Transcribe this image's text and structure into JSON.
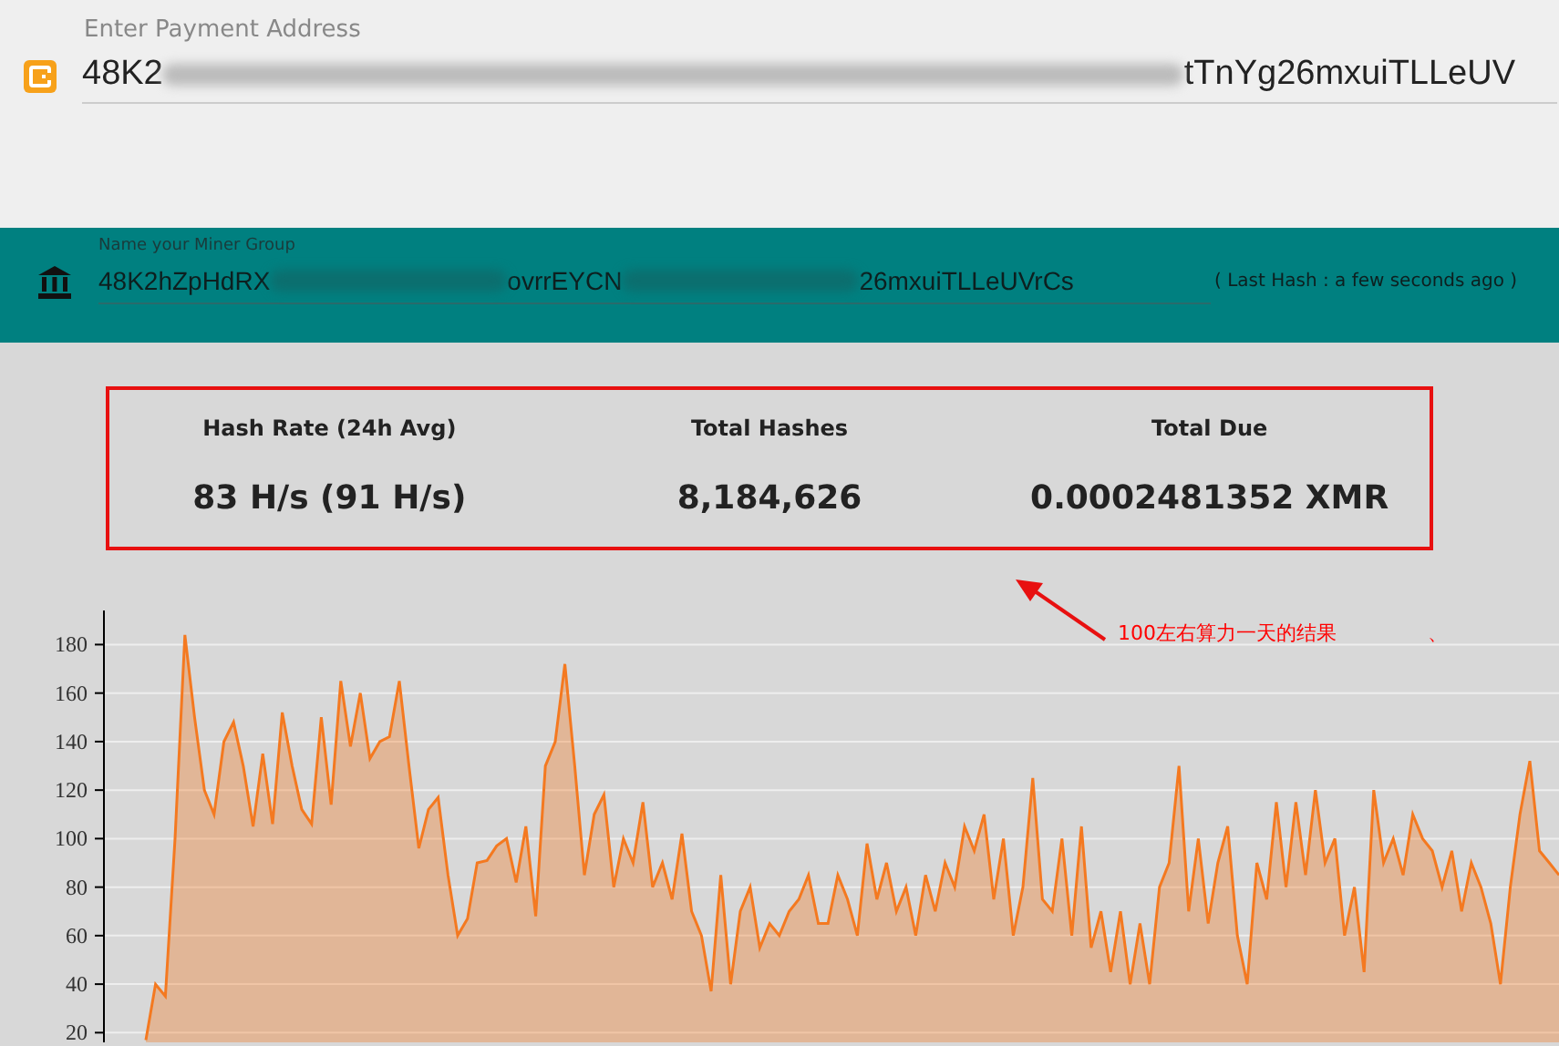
{
  "payment_address": {
    "label": "Enter Payment Address",
    "segments": [
      {
        "kind": "text",
        "text": "48K2"
      },
      {
        "kind": "redacted"
      },
      {
        "kind": "text",
        "text": "tTnYg26mxuiTLLeUV"
      }
    ]
  },
  "miner_group": {
    "label": "Name your Miner Group",
    "segments": [
      {
        "kind": "text",
        "text": "48K2hZpHdRX"
      },
      {
        "kind": "redacted"
      },
      {
        "kind": "text",
        "text": "ovrrEYCN"
      },
      {
        "kind": "redacted"
      },
      {
        "kind": "text",
        "text": "26mxuiTLLeUVrCs"
      }
    ],
    "last_hash": "( Last Hash : a few seconds ago )"
  },
  "stats": [
    {
      "label": "Hash Rate (24h Avg)",
      "value": "83 H/s (91 H/s)"
    },
    {
      "label": "Total Hashes",
      "value": "8,184,626"
    },
    {
      "label": "Total Due",
      "value": "0.0002481352 XMR"
    }
  ],
  "annotation": {
    "text": "100左右算力一天的结果",
    "mark": "、"
  },
  "chart_data": {
    "type": "area",
    "ylim": [
      16,
      194
    ],
    "yticks": [
      20,
      40,
      60,
      80,
      100,
      120,
      140,
      160,
      180
    ],
    "grid": true,
    "series": [
      {
        "color": "#f47920",
        "values": [
          17,
          40,
          35,
          100,
          184,
          150,
          120,
          110,
          140,
          148,
          130,
          105,
          135,
          106,
          152,
          130,
          112,
          106,
          150,
          114,
          165,
          138,
          160,
          133,
          140,
          142,
          165,
          130,
          96,
          112,
          117,
          85,
          60,
          67,
          90,
          91,
          97,
          100,
          82,
          105,
          68,
          130,
          140,
          172,
          130,
          85,
          110,
          118,
          80,
          100,
          90,
          115,
          80,
          90,
          75,
          102,
          70,
          60,
          37,
          85,
          40,
          70,
          80,
          55,
          65,
          60,
          70,
          75,
          85,
          65,
          65,
          85,
          75,
          60,
          98,
          75,
          90,
          70,
          80,
          60,
          85,
          70,
          90,
          80,
          105,
          95,
          110,
          75,
          100,
          60,
          80,
          125,
          75,
          70,
          100,
          60,
          105,
          55,
          70,
          45,
          70,
          40,
          65,
          40,
          80,
          90,
          130,
          70,
          100,
          65,
          90,
          105,
          60,
          40,
          90,
          75,
          115,
          80,
          115,
          85,
          120,
          90,
          100,
          60,
          80,
          45,
          120,
          90,
          100,
          85,
          110,
          100,
          95,
          80,
          95,
          70,
          90,
          80,
          65,
          40,
          80,
          110,
          132,
          95,
          90,
          85
        ]
      }
    ]
  }
}
